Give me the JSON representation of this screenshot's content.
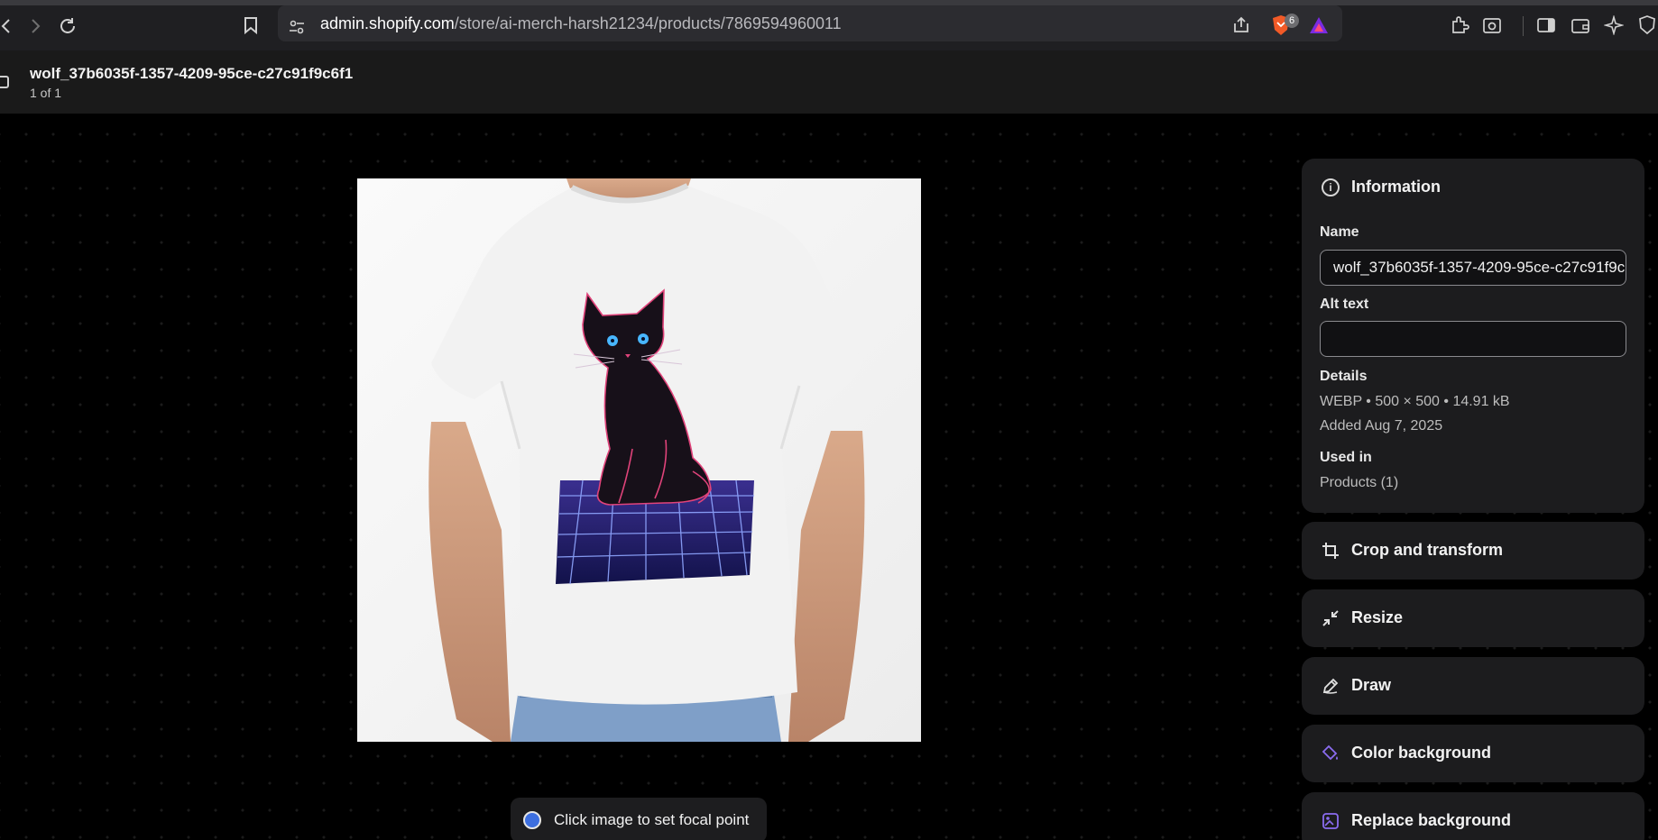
{
  "browser": {
    "url_host": "admin.shopify.com",
    "url_path": "/store/ai-merch-harsh21234/products/7869594960011",
    "notification_badge": "6"
  },
  "header": {
    "file_name": "wolf_37b6035f-1357-4209-95ce-c27c91f9c6f1",
    "position": "1 of 1"
  },
  "focal": {
    "label": "Click image to set focal point"
  },
  "info": {
    "title": "Information",
    "name_label": "Name",
    "name_value": "wolf_37b6035f-1357-4209-95ce-c27c91f9c6f1",
    "alt_label": "Alt text",
    "alt_value": "",
    "details_label": "Details",
    "details_value": "WEBP • 500 × 500 • 14.91 kB",
    "added_value": "Added Aug 7, 2025",
    "used_in_label": "Used in",
    "used_in_value": "Products (1)"
  },
  "actions": {
    "crop": "Crop and transform",
    "resize": "Resize",
    "draw": "Draw",
    "color_bg": "Color background",
    "replace_bg": "Replace background"
  },
  "colors": {
    "accent_purple": "#8b6cf0",
    "focal_dot": "#3d6fe0"
  }
}
